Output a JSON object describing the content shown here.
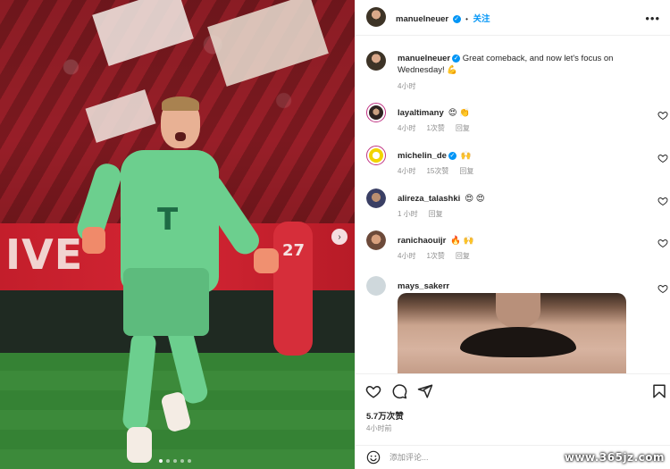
{
  "post": {
    "owner": "manuelneuer",
    "follow_label": "关注",
    "separator": "•",
    "more_label": "•••",
    "caption": "Great comeback, and now let's focus on Wednesday! 💪",
    "caption_time": "4小时",
    "likes": "5.7万次赞",
    "post_time": "4小时前",
    "add_comment_placeholder": "添加评论...",
    "carousel_count": 5,
    "carousel_active": 0
  },
  "photo": {
    "banner_text": "IVE",
    "jersey_logo": "T",
    "teammate_number": "27"
  },
  "comments": [
    {
      "user": "layaltimany",
      "text": "😍 👏",
      "time": "4小时",
      "likes": "1次赞",
      "reply": "回复",
      "verified": false
    },
    {
      "user": "michelin_de",
      "text": "🙌",
      "time": "4小时",
      "likes": "15次赞",
      "reply": "回复",
      "verified": true
    },
    {
      "user": "alireza_talashki",
      "text": "😍 😍",
      "time": "1 小时",
      "likes": "",
      "reply": "回复",
      "verified": false
    },
    {
      "user": "ranichaouijr",
      "text": "🔥 🙌",
      "time": "4小时",
      "likes": "1次赞",
      "reply": "回复",
      "verified": false
    },
    {
      "user": "mays_sakerr",
      "text": "",
      "time": "",
      "likes": "",
      "reply": "",
      "verified": false
    }
  ],
  "watermark": "www.365jz.com",
  "colors": {
    "accent": "#0095f6",
    "text": "#262626",
    "muted": "#8e8e8e",
    "border": "#efefef"
  }
}
